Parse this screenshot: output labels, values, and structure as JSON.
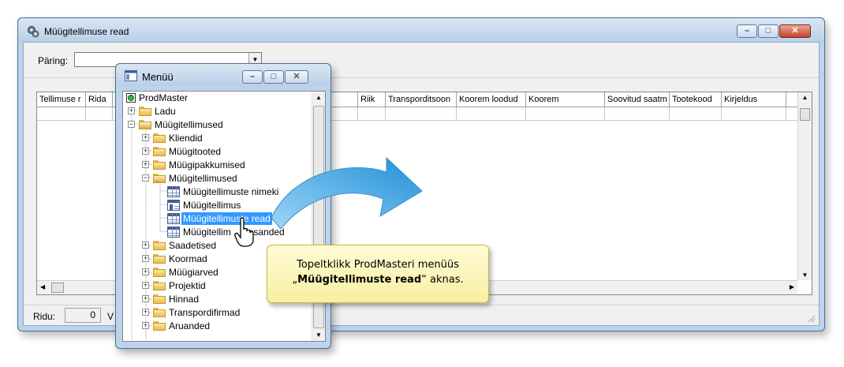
{
  "main_window": {
    "title": "Müügitellimuse read",
    "query_label": "Päring:",
    "query_value": "",
    "columns": [
      {
        "label": "Tellimuse r"
      },
      {
        "label": "Rida"
      },
      {
        "label": ""
      },
      {
        "label": "i"
      },
      {
        "label": "Riik"
      },
      {
        "label": "Transporditsoon"
      },
      {
        "label": "Koorem loodud"
      },
      {
        "label": "Koorem"
      },
      {
        "label": "Soovitud saatm"
      },
      {
        "label": "Tootekood"
      },
      {
        "label": "Kirjeldus"
      }
    ],
    "rows_label": "Ridu:",
    "rows_count": "0",
    "status_extra": "V"
  },
  "menu_window": {
    "title": "Menüü",
    "tree": [
      {
        "label": "ProdMaster",
        "icon": "root-icon",
        "expander": ""
      },
      {
        "label": "Ladu",
        "icon": "folder-icon",
        "expander": "+"
      },
      {
        "label": "Müügitellimused",
        "icon": "folder-open-icon",
        "expander": "−"
      },
      {
        "label": "Kliendid",
        "icon": "folder-icon",
        "expander": "+"
      },
      {
        "label": "Müügitooted",
        "icon": "folder-icon",
        "expander": "+"
      },
      {
        "label": "Müügipakkumised",
        "icon": "folder-icon",
        "expander": "+"
      },
      {
        "label": "Müügitellimused",
        "icon": "folder-open-icon",
        "expander": "−"
      },
      {
        "label": "Müügitellimuste nimeki",
        "icon": "table-icon",
        "expander": ""
      },
      {
        "label": "Müügitellimus",
        "icon": "form-icon",
        "expander": ""
      },
      {
        "label": "Müügitellimuste read",
        "icon": "table-icon",
        "expander": "",
        "selected": true
      },
      {
        "label": "Müügitellim     ilesanded",
        "icon": "table-icon",
        "expander": ""
      },
      {
        "label": "Saadetised",
        "icon": "folder-icon",
        "expander": "+"
      },
      {
        "label": "Koormad",
        "icon": "folder-icon",
        "expander": "+"
      },
      {
        "label": "Müügiarved",
        "icon": "folder-icon",
        "expander": "+"
      },
      {
        "label": "Projektid",
        "icon": "folder-icon",
        "expander": "+"
      },
      {
        "label": "Hinnad",
        "icon": "folder-icon",
        "expander": "+"
      },
      {
        "label": "Transpordifirmad",
        "icon": "folder-icon",
        "expander": "+"
      },
      {
        "label": "Aruanded",
        "icon": "folder-icon",
        "expander": "+"
      }
    ]
  },
  "callout": {
    "line1": "Topeltklikk ProdMasteri menüüs",
    "quote_open": "„",
    "bold": "Müügitellimuste read",
    "quote_close": "“ aknas."
  },
  "colors": {
    "selection": "#3399ff",
    "arrow": "#3aa6e8",
    "callout_bg": "#fbf3b8",
    "window_frame": "#bcd3ec"
  }
}
